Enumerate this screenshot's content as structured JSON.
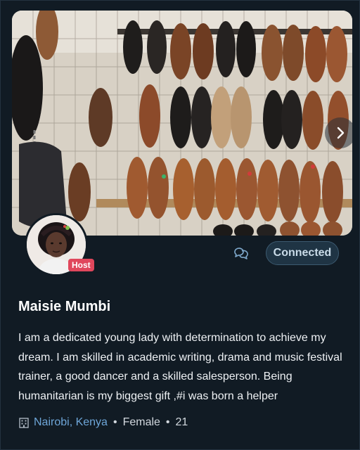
{
  "cover": {
    "next_icon": "chevron-right-icon"
  },
  "profile": {
    "host_badge": "Host",
    "connected_label": "Connected",
    "chat_icon": "chat-bubbles-icon",
    "name": "Maisie Mumbi",
    "bio": "I am a dedicated young lady with determination to achieve my dream. I am skilled in academic writing, drama and music festival trainer, a good dancer and a skilled salesperson. Being humanitarian is my biggest gift ,#i was born a helper",
    "location": "Nairobi, Kenya",
    "gender": "Female",
    "age": "21",
    "location_icon": "building-icon"
  },
  "colors": {
    "background": "#111b24",
    "host_badge": "#e0475c",
    "link": "#6ea6d8",
    "connected_bg": "#1f3444"
  }
}
